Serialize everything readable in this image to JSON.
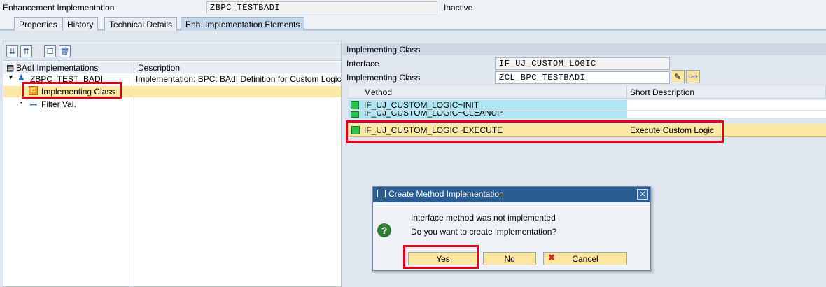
{
  "header": {
    "label": "Enhancement Implementation",
    "value": "ZBPC_TESTBADI",
    "status": "Inactive"
  },
  "tabs": [
    {
      "label": "Properties"
    },
    {
      "label": "History"
    },
    {
      "label": "Technical Details"
    },
    {
      "label": "Enh. Implementation Elements"
    }
  ],
  "tree": {
    "columns": [
      "BAdI Implementations",
      "Description"
    ],
    "rows": [
      {
        "name": "ZBPC_TEST_BADI",
        "desc": "Implementation: BPC: BAdI Definition for Custom Logic"
      },
      {
        "name": "Implementing Class",
        "desc": ""
      },
      {
        "name": "Filter Val.",
        "desc": ""
      }
    ]
  },
  "right": {
    "title": "Implementing Class",
    "interface_label": "Interface",
    "interface_value": "IF_UJ_CUSTOM_LOGIC",
    "class_label": "Implementing Class",
    "class_value": "ZCL_BPC_TESTBADI",
    "grid_columns": [
      "Method",
      "Short Description"
    ],
    "methods": [
      {
        "method": "IF_UJ_CUSTOM_LOGIC~INIT",
        "desc": ""
      },
      {
        "method": "IF_UJ_CUSTOM_LOGIC~CLEANUP",
        "desc": ""
      },
      {
        "method": "IF_UJ_CUSTOM_LOGIC~EXECUTE",
        "desc": "Execute Custom Logic"
      }
    ]
  },
  "dialog": {
    "title": "Create Method Implementation",
    "line1": "Interface method was not implemented",
    "line2": "Do you want to create implementation?",
    "yes": "Yes",
    "no": "No",
    "cancel": "Cancel"
  },
  "colors": {
    "highlight": "#e2001a",
    "selection": "#fde9a5",
    "title_bar": "#2b5c92"
  }
}
